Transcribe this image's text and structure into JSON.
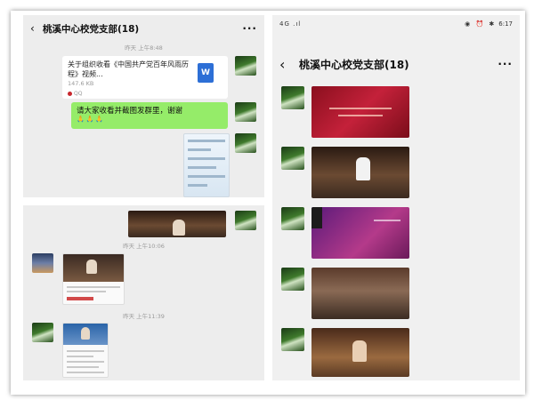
{
  "left_top": {
    "header": {
      "back_icon": "chevron-left-icon",
      "title": "桃溪中心校党支部(18)",
      "more_icon": "ellipsis-icon",
      "more_text": "···"
    },
    "timestamp": "昨天 上午8:48",
    "file_message": {
      "name": "关于组织收看《中国共产党百年风雨历程》视频...",
      "size": "147.6 KB",
      "source": "QQ",
      "file_icon": "word-doc-icon",
      "file_icon_text": "W"
    },
    "text_message": {
      "text": "请大家收看并截图发群里，谢谢",
      "emoji": "🙏🙏🙏"
    }
  },
  "left_bottom": {
    "timestamp_1": "昨天 上午10:06",
    "timestamp_2": "昨天 上午11:39"
  },
  "right": {
    "status_bar": {
      "signal": "4G .ıl",
      "icons": "◉ ⏰ ✱",
      "time": "6:17"
    },
    "header": {
      "back_icon": "chevron-left-icon",
      "title": "桃溪中心校党支部(18)",
      "more_text": "···"
    }
  },
  "colors": {
    "chat_bg": "#ededed",
    "sent_bubble": "#95ec69",
    "accent_red": "#c4213a"
  }
}
